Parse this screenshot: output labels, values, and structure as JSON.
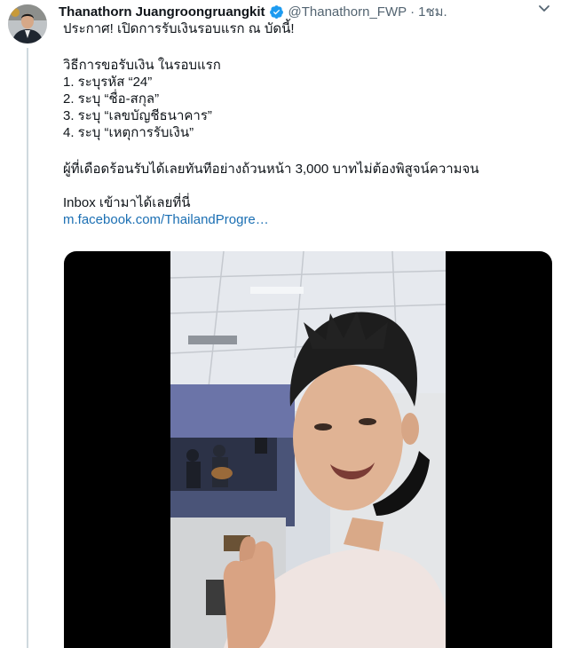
{
  "tweet": {
    "author_name": "Thanathorn Juangroongruangkit",
    "handle": "@Thanathorn_FWP",
    "separator": "·",
    "time": "1ชม.",
    "lines": [
      "ประกาศ! เปิดการรับเงินรอบแรก ณ บัดนี้!",
      "วิธีการขอรับเงิน ในรอบแรก",
      "1. ระบุรหัส “24”",
      "2. ระบุ “ชื่อ-สกุล”",
      "3. ระบุ “เลขบัญชีธนาคาร”",
      "4. ระบุ “เหตุการรับเงิน”",
      "ผู้ที่เดือดร้อนรับได้เลยทันทีอย่างถ้วนหน้า 3,000 บาทไม่ต้องพิสูจน์ความจน",
      "Inbox เข้ามาได้เลยที่นี่"
    ],
    "link": "m.facebook.com/ThailandProgre…"
  },
  "icons": {
    "verified": "verified-badge-icon",
    "more": "chevron-down-icon"
  },
  "colors": {
    "link": "#1b6fb3",
    "verified": "#1d9bf0",
    "secondary_text": "#536471",
    "thread_line": "#cfd9de"
  }
}
